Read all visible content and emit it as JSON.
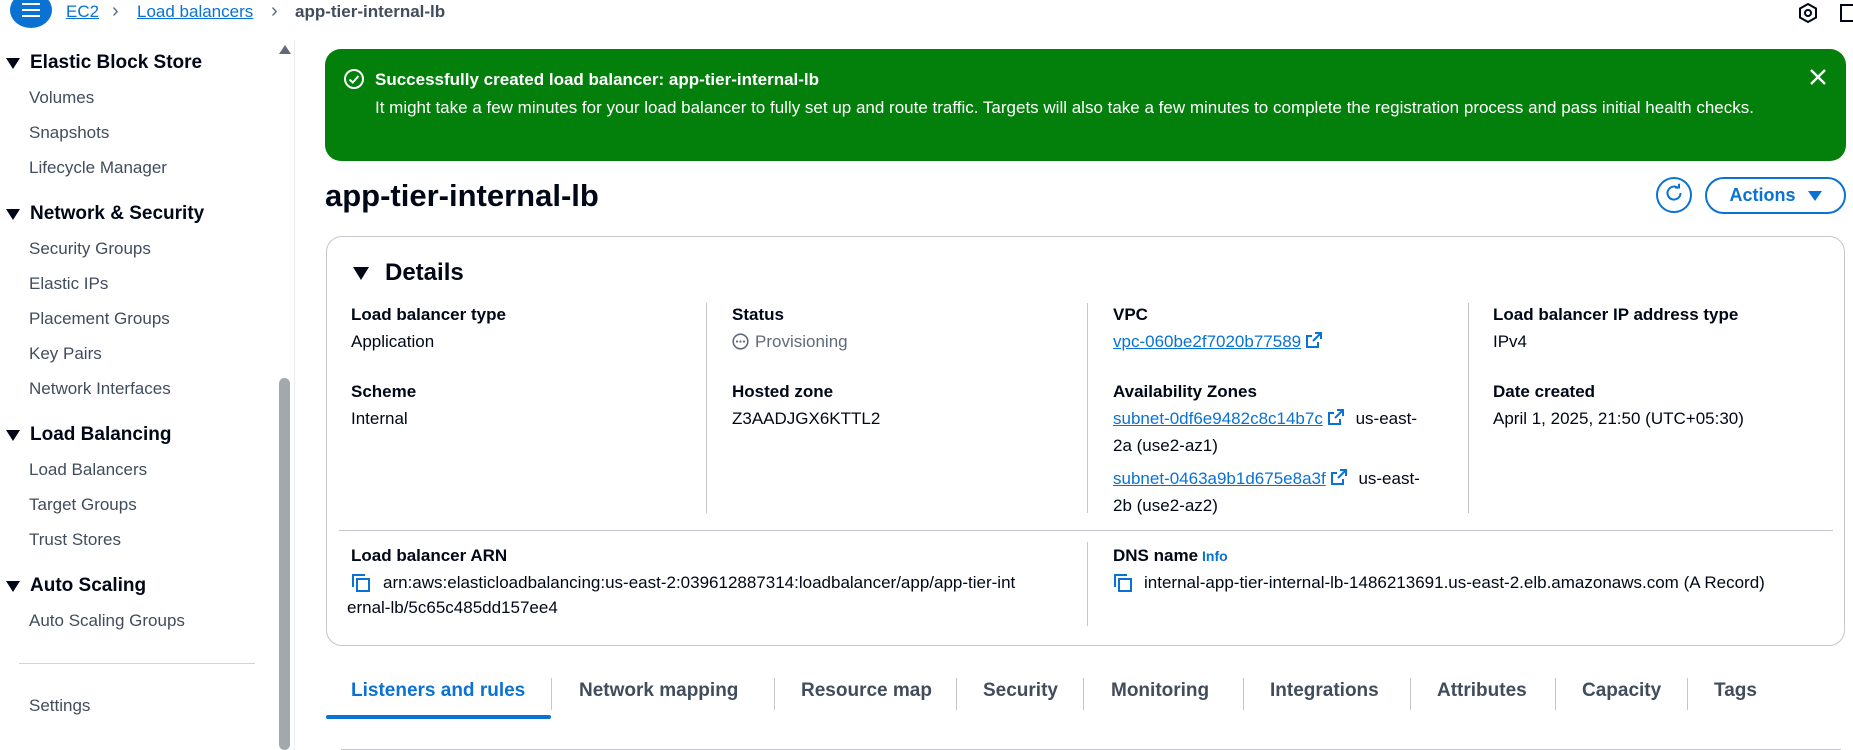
{
  "breadcrumb": {
    "items": [
      "EC2",
      "Load balancers"
    ],
    "current": "app-tier-internal-lb"
  },
  "sidebar": {
    "sections": [
      {
        "title": "Elastic Block Store",
        "items": [
          "Volumes",
          "Snapshots",
          "Lifecycle Manager"
        ]
      },
      {
        "title": "Network & Security",
        "items": [
          "Security Groups",
          "Elastic IPs",
          "Placement Groups",
          "Key Pairs",
          "Network Interfaces"
        ]
      },
      {
        "title": "Load Balancing",
        "items": [
          "Load Balancers",
          "Target Groups",
          "Trust Stores"
        ]
      },
      {
        "title": "Auto Scaling",
        "items": [
          "Auto Scaling Groups"
        ]
      }
    ],
    "settings": "Settings"
  },
  "flash": {
    "title": "Successfully created load balancer: ",
    "title_name": "app-tier-internal-lb",
    "message": "It might take a few minutes for your load balancer to fully set up and route traffic. Targets will also take a few minutes to complete the registration process and pass initial health checks.",
    "color": "#037f0c"
  },
  "header": {
    "title": "app-tier-internal-lb",
    "actions_label": "Actions"
  },
  "details": {
    "heading": "Details",
    "lb_type_label": "Load balancer type",
    "lb_type": "Application",
    "status_label": "Status",
    "status": "Provisioning",
    "vpc_label": "VPC",
    "vpc": "vpc-060be2f7020b77589",
    "ip_type_label": "Load balancer IP address type",
    "ip_type": "IPv4",
    "scheme_label": "Scheme",
    "scheme": "Internal",
    "hosted_zone_label": "Hosted zone",
    "hosted_zone": "Z3AADJGX6KTTL2",
    "az_label": "Availability Zones",
    "az": [
      {
        "subnet": "subnet-0df6e9482c8c14b7c",
        "zone_a": "us-east-",
        "zone_b": "2a (use2-az1)"
      },
      {
        "subnet": "subnet-0463a9b1d675e8a3f",
        "zone_a": "us-east-",
        "zone_b": "2b (use2-az2)"
      }
    ],
    "date_label": "Date created",
    "date": "April 1, 2025, 21:50 (UTC+05:30)",
    "arn_label": "Load balancer ARN",
    "arn_line1": "arn:aws:elasticloadbalancing:us-east-2:039612887314:loadbalancer/app/app-tier-int",
    "arn_line2": "ernal-lb/5c65c485dd157ee4",
    "dns_label": "DNS name",
    "dns_info": "Info",
    "dns": "internal-app-tier-internal-lb-1486213691.us-east-2.elb.amazonaws.com (A Record)"
  },
  "tabs": [
    "Listeners and rules",
    "Network mapping",
    "Resource map",
    "Security",
    "Monitoring",
    "Integrations",
    "Attributes",
    "Capacity",
    "Tags"
  ],
  "colors": {
    "accent": "#0972d3",
    "success": "#037f0c"
  }
}
